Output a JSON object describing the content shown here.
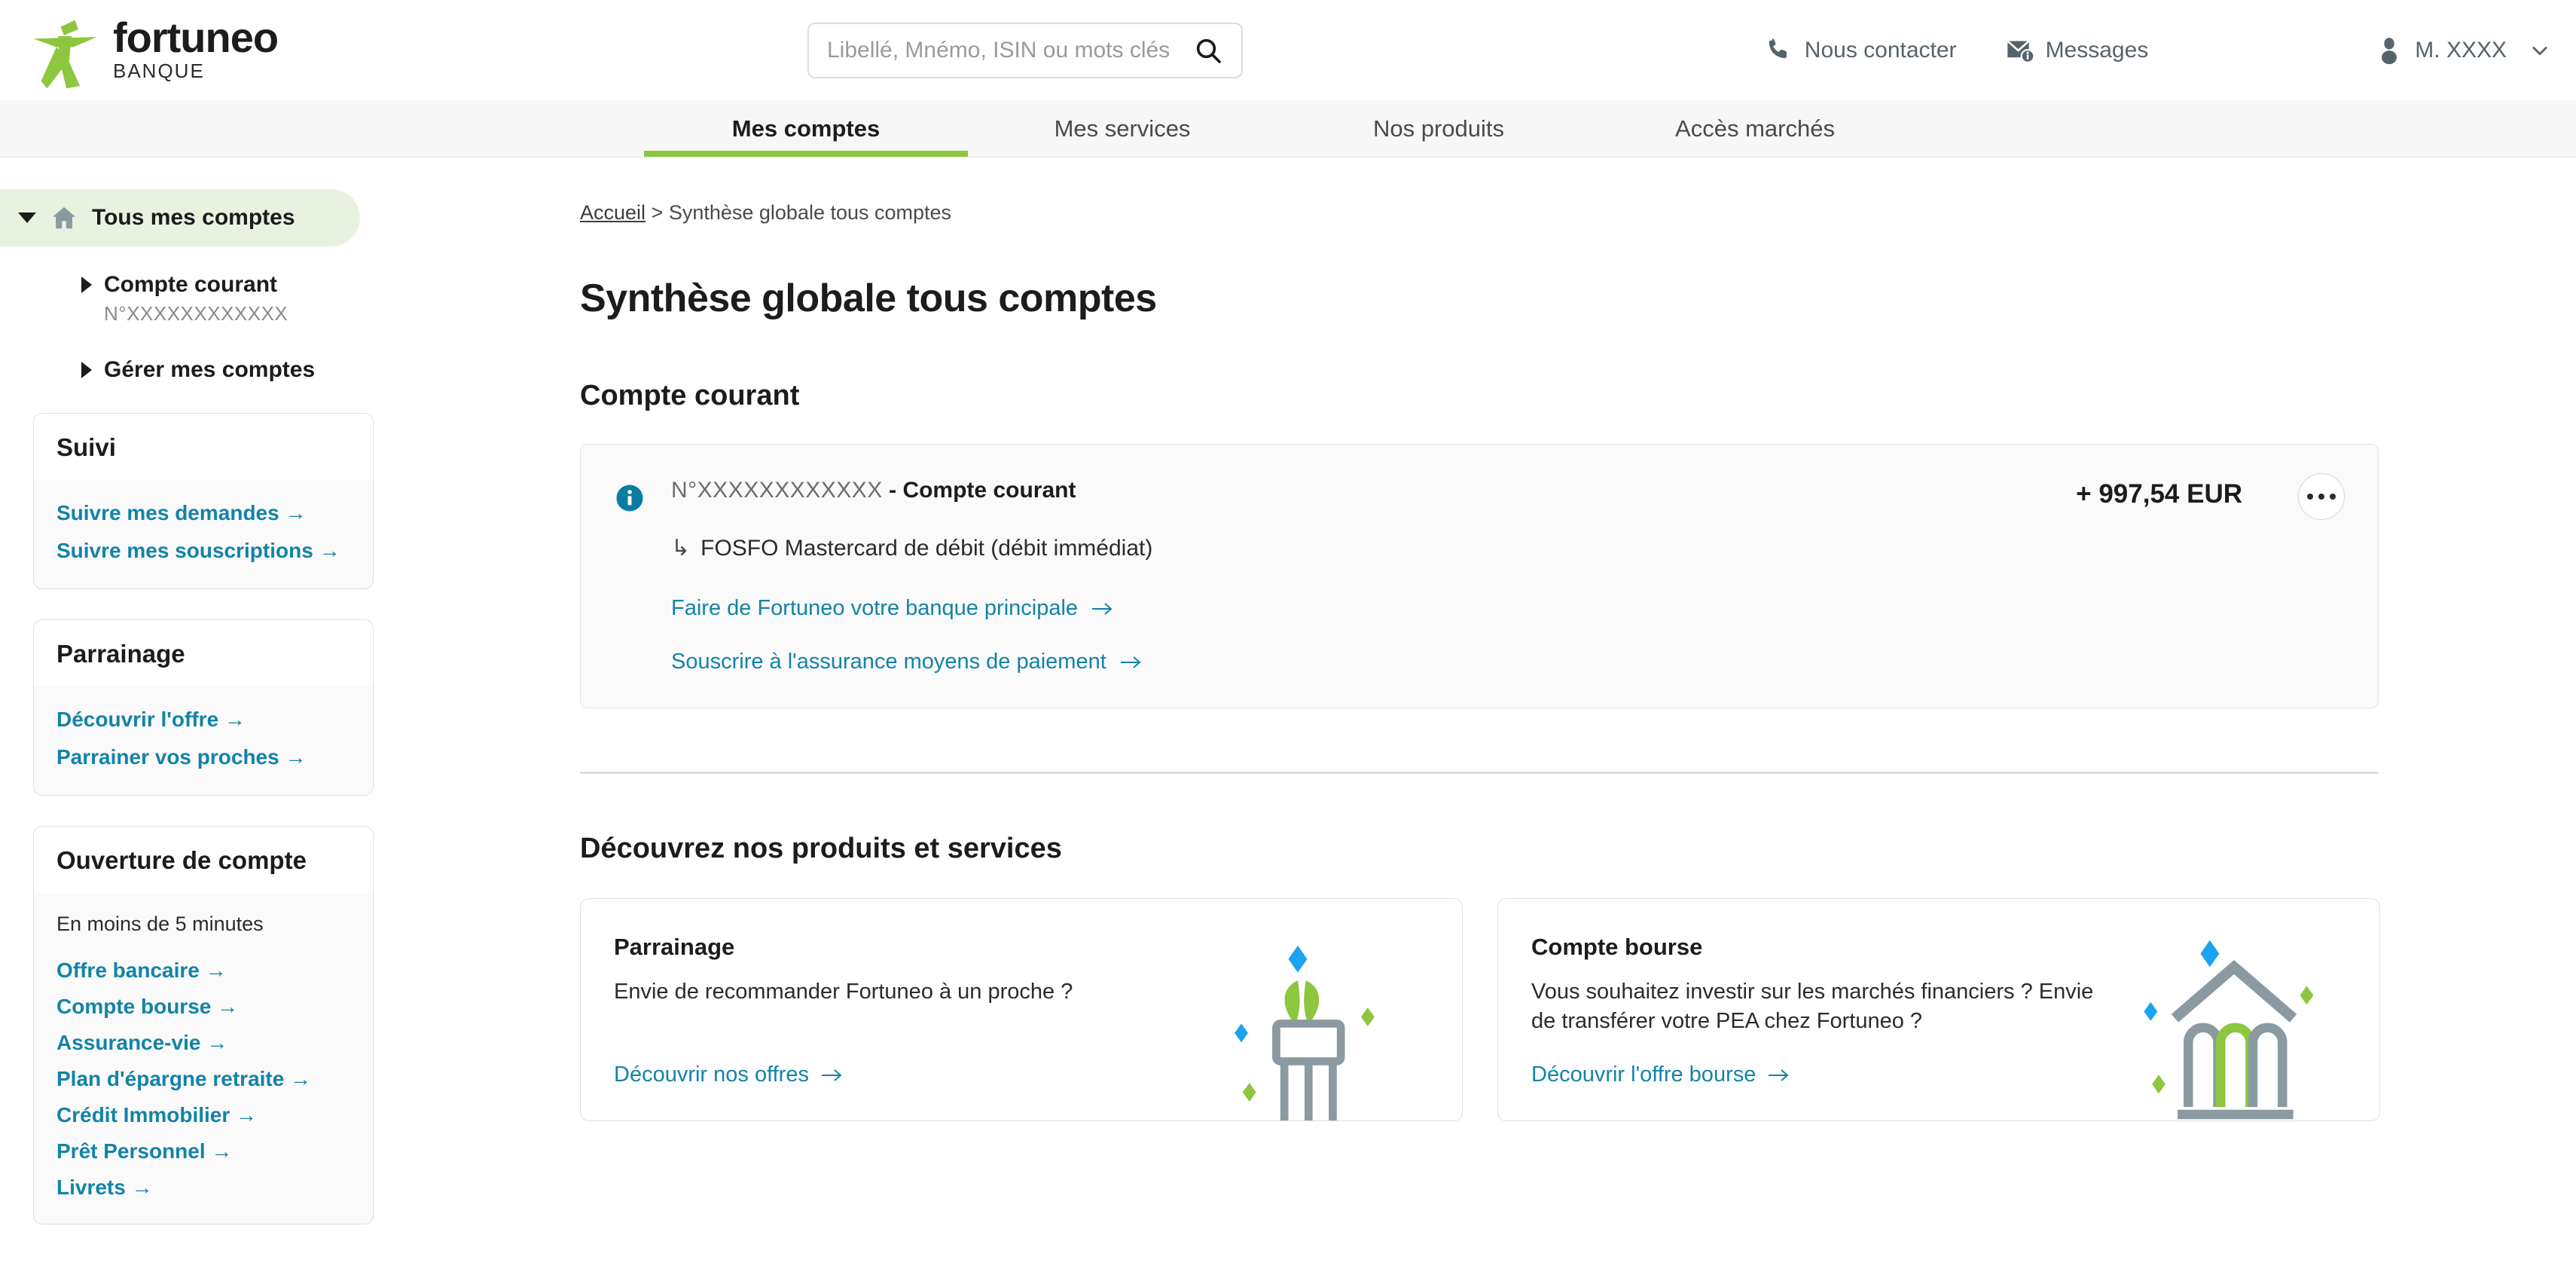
{
  "brand": {
    "name": "fortuneo",
    "subtitle": "BANQUE",
    "logo_icon": "fortuneo-star-man-logo",
    "green": "#8dc63f",
    "link_blue": "#1383a8"
  },
  "search": {
    "placeholder": "Libellé, Mnémo, ISIN ou mots clés",
    "value": "",
    "icon": "search-icon"
  },
  "header": {
    "contact_label": "Nous contacter",
    "contact_icon": "phone-icon",
    "messages_label": "Messages",
    "messages_icon": "envelope-info-icon",
    "user_label": "M. XXXX",
    "user_icon": "user-avatar-icon",
    "user_chevron": "chevron-down-icon"
  },
  "nav": {
    "tabs": [
      {
        "label": "Mes comptes",
        "active": true
      },
      {
        "label": "Mes services",
        "active": false
      },
      {
        "label": "Nos produits",
        "active": false
      },
      {
        "label": "Accès marchés",
        "active": false
      }
    ]
  },
  "sidebar": {
    "main_item": {
      "label": "Tous mes comptes",
      "icon": "home-icon",
      "expanded_icon": "triangle-down-icon"
    },
    "sub_items": [
      {
        "label": "Compte courant",
        "number": "N°XXXXXXXXXXXX",
        "icon": "triangle-right-icon"
      },
      {
        "label": "Gérer mes comptes",
        "icon": "triangle-right-icon"
      }
    ],
    "cards": [
      {
        "title": "Suivi",
        "note": "",
        "links": [
          "Suivre mes demandes  →",
          "Suivre mes souscriptions  →"
        ]
      },
      {
        "title": "Parrainage",
        "note": "",
        "links": [
          "Découvrir l'offre  →",
          "Parrainer vos proches  →"
        ]
      },
      {
        "title": "Ouverture de compte",
        "note": "En moins de 5 minutes",
        "links": [
          "Offre bancaire  →",
          "Compte bourse  →",
          "Assurance-vie  →",
          "Plan d'épargne retraite  →",
          "Crédit Immobilier  →",
          "Prêt Personnel  →",
          "Livrets  →"
        ]
      }
    ]
  },
  "main": {
    "breadcrumb": {
      "home": "Accueil",
      "separator": " > ",
      "current": "Synthèse globale tous comptes"
    },
    "page_title": "Synthèse globale tous comptes",
    "section_title": "Compte courant",
    "account": {
      "info_icon": "info-circle-icon",
      "number": "N°XXXXXXXXXXXX",
      "name": " - Compte courant",
      "card_arrow": "↳",
      "card_label": "FOSFO Mastercard de débit (débit immédiat)",
      "link_primary": "Faire de Fortuneo votre banque principale",
      "link_secondary": "Souscrire à l'assurance moyens de paiement",
      "balance": "+ 997,54 EUR",
      "more_button": "more-options-button"
    },
    "products_title": "Découvrez nos produits et services",
    "promos": [
      {
        "title": "Parrainage",
        "description": "Envie de recommander Fortuneo à un proche ?",
        "link": "Découvrir nos offres",
        "art": "gift-plant-illustration"
      },
      {
        "title": "Compte bourse",
        "description": "Vous souhaitez investir sur les marchés financiers ? Envie de transférer votre PEA chez Fortuneo ?",
        "link": "Découvrir l'offre bourse",
        "art": "bank-building-illustration"
      }
    ]
  }
}
